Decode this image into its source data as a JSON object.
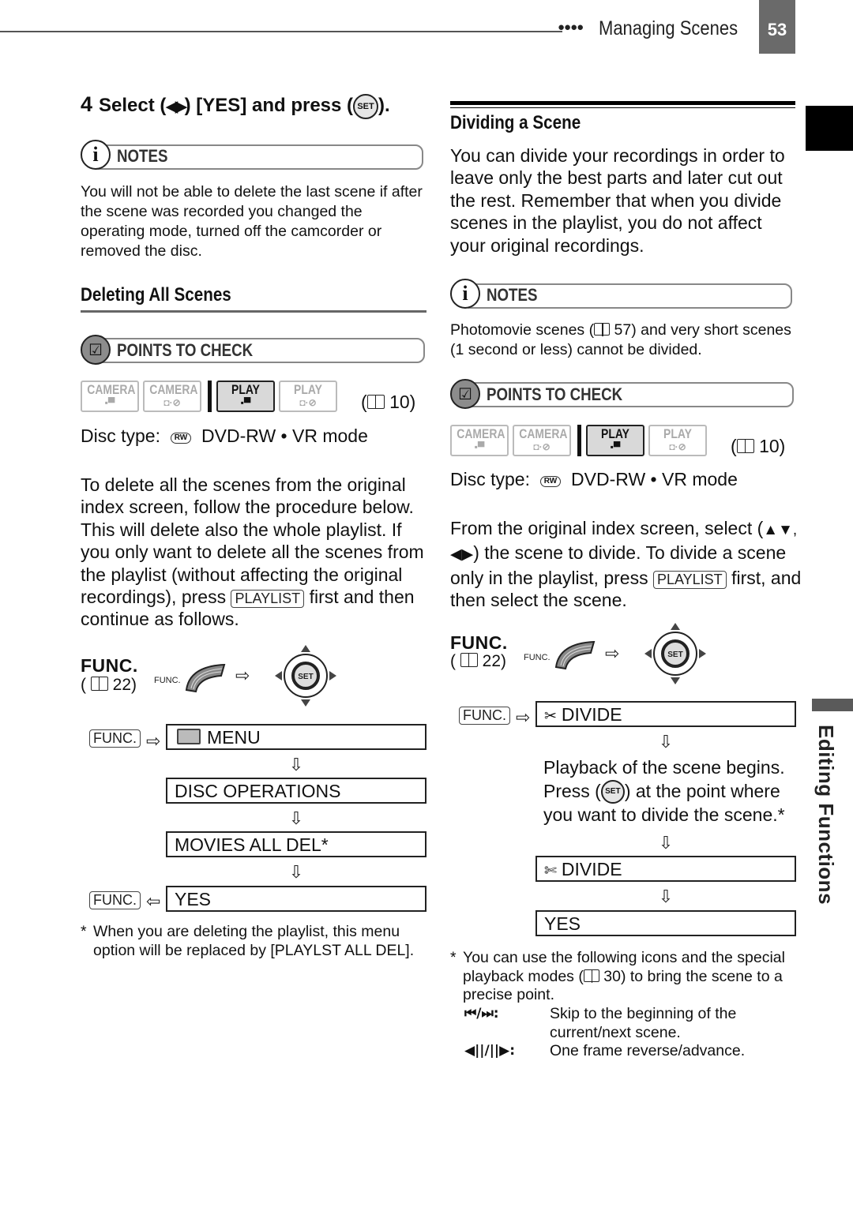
{
  "header": {
    "dots": "●●●●",
    "section_title": "Managing Scenes",
    "page_number": "53",
    "side_label": "Editing Functions"
  },
  "left": {
    "step4": {
      "number": "4",
      "text_a": "Select (",
      "arrows": "◀▶",
      "text_b": ") [YES] and press (",
      "set_label": "SET",
      "text_c": ")."
    },
    "notes": {
      "icon": "info-icon",
      "title": "NOTES",
      "body": "You will not be able to delete the last scene if after the scene was recorded you changed the operating mode, turned off the camcorder or removed the disc."
    },
    "section_title": "Deleting All Scenes",
    "points": {
      "icon": "checkbox-icon",
      "title": "POINTS TO CHECK",
      "modes": [
        {
          "label": "CAMERA",
          "sub": "movie",
          "active": false
        },
        {
          "label": "CAMERA",
          "sub": "photo·disc",
          "active": false
        },
        {
          "label": "PLAY",
          "sub": "movie",
          "active": true
        },
        {
          "label": "PLAY",
          "sub": "photo·disc",
          "active": false
        }
      ],
      "ref": "10",
      "disc_type_label": "Disc type:",
      "disc_icon": "RW",
      "disc_type_value": "DVD-RW • VR mode"
    },
    "intro_a": "To delete all the scenes from the original index screen, follow the procedure below. This will delete also the whole playlist. If you only want to delete all the scenes from the playlist (without affecting the original recordings), press",
    "playlist_key": "PLAYLIST",
    "intro_b": "first and then continue as follows.",
    "func": {
      "big": "FUNC.",
      "ref": "22",
      "small": "FUNC.",
      "set_label": "SET"
    },
    "flow": {
      "func_key": "FUNC.",
      "steps": [
        "MENU",
        "DISC OPERATIONS",
        "MOVIES ALL DEL*",
        "YES"
      ]
    },
    "footnote_mark": "*",
    "footnote": "When you are deleting the playlist, this menu option will be replaced by [PLAYLST ALL DEL]."
  },
  "right": {
    "section_title": "Dividing a Scene",
    "intro": "You can divide your recordings in order to leave only the best parts and later cut out the rest. Remember that when you divide scenes in the playlist, you do not affect your original recordings.",
    "notes": {
      "title": "NOTES",
      "body_a": "Photomovie scenes (",
      "ref": "57",
      "body_b": ") and very short scenes (1 second or less) cannot be divided."
    },
    "points": {
      "title": "POINTS TO CHECK",
      "ref": "10",
      "disc_type_label": "Disc type:",
      "disc_icon": "RW",
      "disc_type_value": "DVD-RW • VR mode"
    },
    "select_a": "From the original index screen, select (",
    "select_arrows": "▲▼, ◀▶",
    "select_b": ") the scene to divide. To divide a scene only in the playlist, press",
    "playlist_key": "PLAYLIST",
    "select_c": "first, and then select the scene.",
    "func": {
      "big": "FUNC.",
      "ref": "22",
      "small": "FUNC.",
      "set_label": "SET"
    },
    "flow": {
      "func_key": "FUNC.",
      "step1": "DIVIDE",
      "instruction_a": "Playback of the scene begins. Press (",
      "instruction_set": "SET",
      "instruction_b": ") at the point where you want to divide the scene.*",
      "step2": "DIVIDE",
      "step3": "YES"
    },
    "footnote_mark": "*",
    "footnote_a": "You can use the following icons and the special playback modes (",
    "footnote_ref": "30",
    "footnote_b": ") to bring the scene to a precise point.",
    "legend": [
      {
        "icons": "⏮/⏭:",
        "desc": "Skip to the beginning of the current/next scene."
      },
      {
        "icons": "◀||/||▶:",
        "desc": "One frame reverse/advance."
      }
    ]
  }
}
